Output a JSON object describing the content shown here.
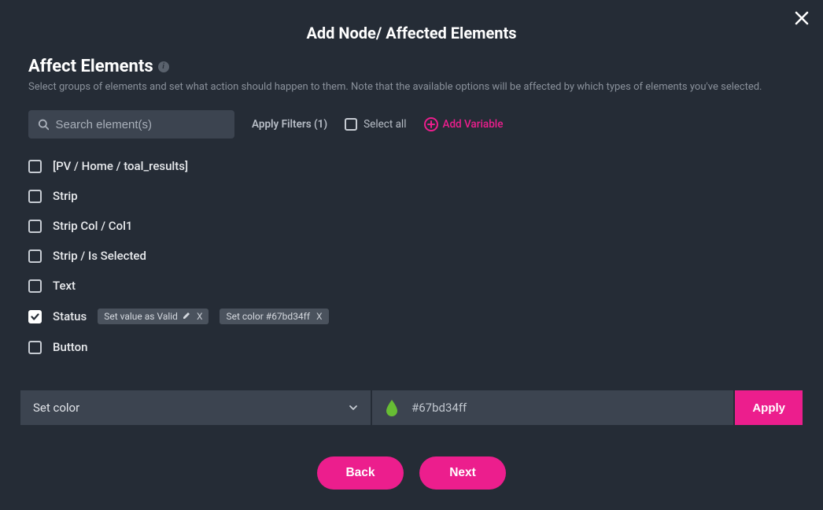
{
  "modal": {
    "title": "Add Node/ Affected Elements",
    "close_icon": "close"
  },
  "section": {
    "title": "Affect Elements",
    "info": "i",
    "description": "Select groups of elements and set what action should happen to them. Note that the available options will be affected by which types of elements you've selected."
  },
  "filters": {
    "search_placeholder": "Search element(s)",
    "apply_filters_label": "Apply Filters (1)",
    "select_all_label": "Select all",
    "add_variable_label": "Add Variable"
  },
  "elements": [
    {
      "label": "[PV / Home / toal_results]",
      "checked": false,
      "tags": []
    },
    {
      "label": "Strip",
      "checked": false,
      "tags": []
    },
    {
      "label": "Strip Col / Col1",
      "checked": false,
      "tags": []
    },
    {
      "label": "Strip / Is Selected",
      "checked": false,
      "tags": []
    },
    {
      "label": "Text",
      "checked": false,
      "tags": []
    },
    {
      "label": "Status",
      "checked": true,
      "tags": [
        {
          "text": "Set value as Valid",
          "editable": true
        },
        {
          "text": "Set color #67bd34ff",
          "editable": false
        }
      ]
    },
    {
      "label": "Button",
      "checked": false,
      "tags": []
    }
  ],
  "action_bar": {
    "dropdown_value": "Set color",
    "color_value": "#67bd34ff",
    "color_swatch": "#67bd34",
    "apply_label": "Apply"
  },
  "nav": {
    "back_label": "Back",
    "next_label": "Next"
  }
}
